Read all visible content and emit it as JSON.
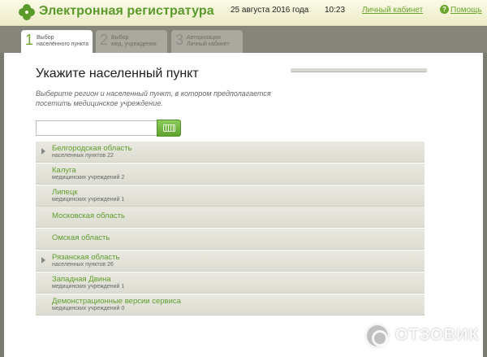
{
  "header": {
    "title": "Электронная регистратура",
    "date": "25 августа 2016 года",
    "time": "10:23",
    "cabinet_link": "Личный кабинет",
    "help_link": "Помощь",
    "logo_icon": "clover-icon",
    "help_icon": "question-icon"
  },
  "steps": [
    {
      "num": "1",
      "line1": "Выбор",
      "line2": "населённого пункта",
      "active": true
    },
    {
      "num": "2",
      "line1": "Выбор",
      "line2": "мед. учреждения",
      "active": false
    },
    {
      "num": "3",
      "line1": "Авторизация",
      "line2": "Личный кабинет",
      "active": false
    }
  ],
  "main": {
    "title": "Укажите населенный пункт",
    "subtitle": "Выберите регион и населенный пункт, в котором предполагается посетить медицинское учреждение.",
    "search_value": "",
    "keyboard_icon": "keyboard-icon"
  },
  "regions": [
    {
      "name": "Белгородская область",
      "meta": "населенных пунктов 22",
      "expandable": true
    },
    {
      "name": "Калуга",
      "meta": "медицинских учреждений 2",
      "expandable": false
    },
    {
      "name": "Липецк",
      "meta": "медицинских учреждений 1",
      "expandable": false
    },
    {
      "name": "Московская область",
      "meta": "",
      "expandable": false
    },
    {
      "name": "Омская область",
      "meta": "",
      "expandable": false
    },
    {
      "name": "Рязанская область",
      "meta": "населенных пунктов 26",
      "expandable": true
    },
    {
      "name": "Западная Двина",
      "meta": "медицинских учреждений 1",
      "expandable": false
    },
    {
      "name": "Демонстрационные версии сервиса",
      "meta": "медицинских учреждений 0",
      "expandable": false
    }
  ],
  "watermark": {
    "text": "ОТЗОВИК"
  },
  "colors": {
    "accent": "#6aa62e",
    "header_bg": "#f4f3d6",
    "frame": "#85857c"
  }
}
